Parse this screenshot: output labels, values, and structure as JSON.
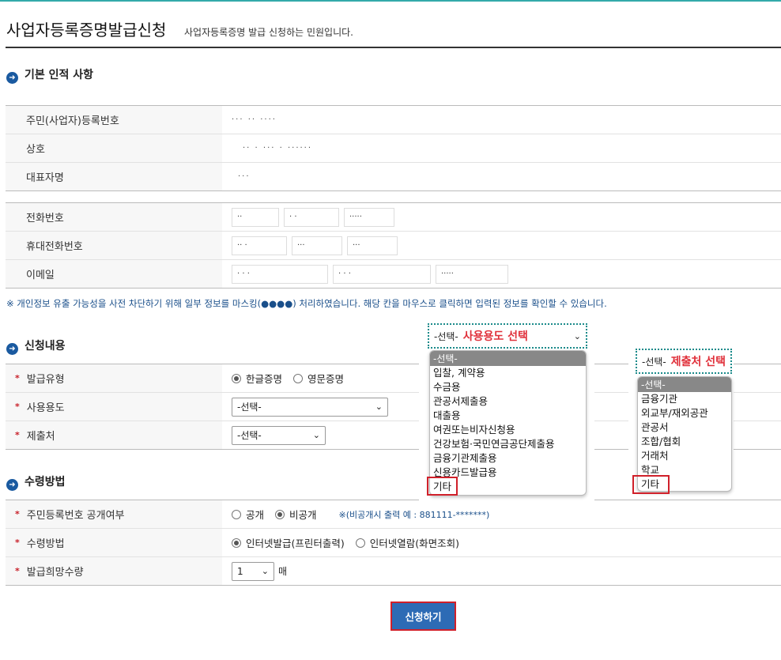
{
  "header": {
    "title": "사업자등록증명발급신청",
    "desc": "사업자등록증명 발급 신청하는 민원입니다."
  },
  "basic": {
    "section": "기본 인적 사항",
    "rows": [
      {
        "label": "주민(사업자)등록번호",
        "value": "··· ·· ····"
      },
      {
        "label": "상호",
        "value": "·· · ··· · ······"
      },
      {
        "label": "대표자명",
        "value": "···"
      }
    ],
    "contact": [
      {
        "label": "전화번호",
        "parts": [
          "··",
          "·  ·",
          "·····"
        ]
      },
      {
        "label": "휴대전화번호",
        "parts": [
          "·· ·",
          "···",
          "···"
        ]
      },
      {
        "label": "이메일",
        "parts": [
          "· · ·",
          "·  ·  ·",
          "·····"
        ]
      }
    ],
    "notice": "※ 개인정보 유출 가능성을 사전 차단하기 위해 일부 정보를 마스킹(●●●●) 처리하였습니다. 해당 칸을 마우스로 클릭하면 입력된 정보를 확인할 수 있습니다."
  },
  "apply": {
    "section": "신청내용",
    "type_label": "발급유형",
    "type_options": [
      "한글증명",
      "영문증명"
    ],
    "purpose_label": "사용용도",
    "purpose_value": "-선택-",
    "submit_to_label": "제출처",
    "submit_to_value": "-선택-"
  },
  "receive": {
    "section": "수령방법",
    "disclose_label": "주민등록번호 공개여부",
    "disclose_options": [
      "공개",
      "비공개"
    ],
    "disclose_note": "※(비공개시 출력 예 : 881111-*******)",
    "method_label": "수령방법",
    "method_options": [
      "인터넷발급(프린터출력)",
      "인터넷열람(화면조회)"
    ],
    "qty_label": "발급희망수량",
    "qty_value": "1",
    "qty_unit": "매"
  },
  "submit_label": "신청하기",
  "overlay_purpose": {
    "head": "-선택-",
    "annot": "사용용도 선택",
    "options": [
      "-선택-",
      "입찰, 계약용",
      "수금용",
      "관공서제출용",
      "대출용",
      "여권또는비자신청용",
      "건강보험·국민연금공단제출용",
      "금융기관제출용",
      "신용카드발급용",
      "기타"
    ]
  },
  "overlay_submit": {
    "head": "-선택-",
    "annot": "제출처 선택",
    "options": [
      "-선택-",
      "금융기관",
      "외교부/재외공관",
      "관공서",
      "조합/협회",
      "거래처",
      "학교",
      "기타"
    ]
  }
}
